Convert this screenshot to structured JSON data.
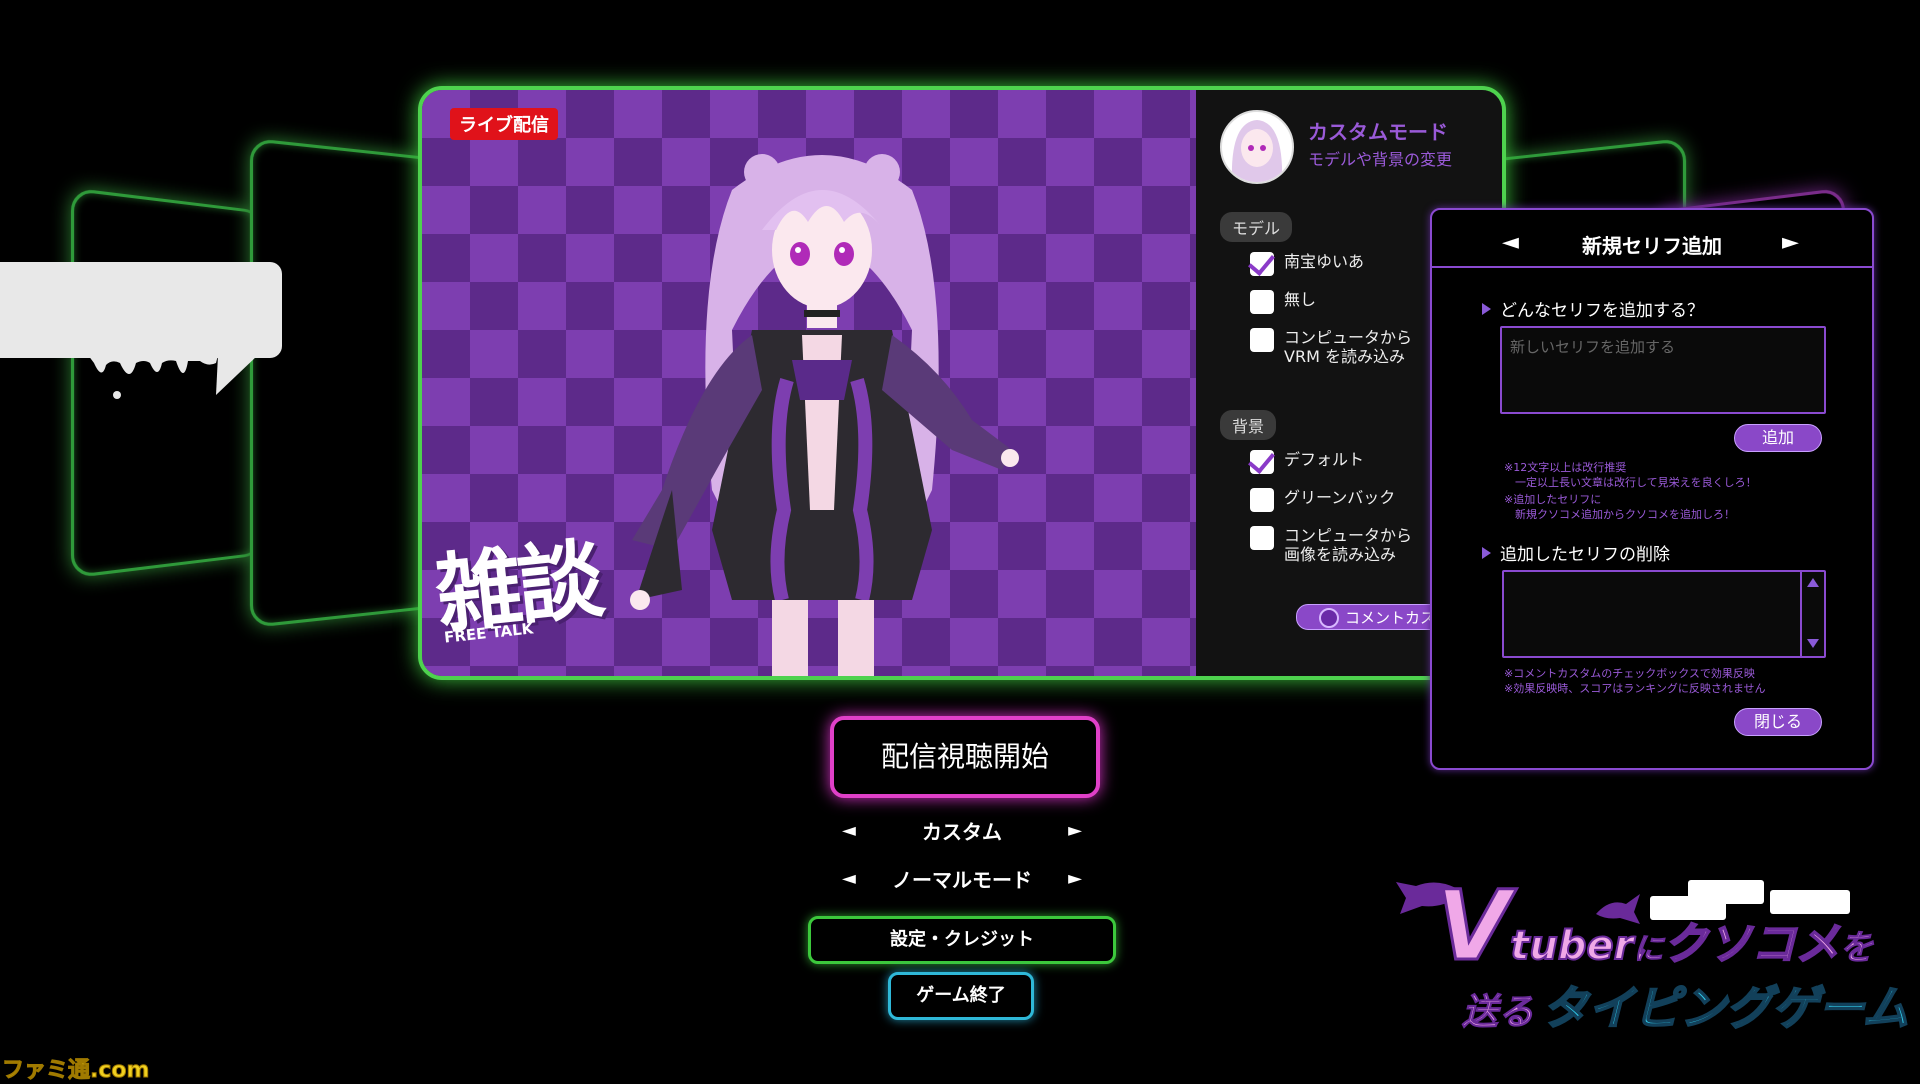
{
  "stream": {
    "live_badge": "ライブ配信",
    "overlay_logo_main": "雑談",
    "overlay_logo_sub": "FREE TALK"
  },
  "side_panel": {
    "mode_title": "カスタムモード",
    "mode_subtitle": "モデルや背景の変更",
    "model_section": "モデル",
    "model_options": [
      {
        "label": "南宝ゆいあ",
        "checked": true
      },
      {
        "label": "無し",
        "checked": false
      },
      {
        "label": "コンピュータから\nVRM を読み込み",
        "checked": false
      }
    ],
    "background_section": "背景",
    "background_options": [
      {
        "label": "デフォルト",
        "checked": true
      },
      {
        "label": "グリーンバック",
        "checked": false
      },
      {
        "label": "コンピュータから\n画像を読み込み",
        "checked": false
      }
    ],
    "comment_custom_toggle": "コメントカス"
  },
  "dialog": {
    "title": "新規セリフ追加",
    "prev_arrow": "◄",
    "next_arrow": "►",
    "add_section": "どんなセリフを追加する？",
    "input_placeholder": "新しいセリフを追加する",
    "add_button": "追加",
    "note1": "※12文字以上は改行推奨",
    "note2": "　一定以上長い文章は改行して見栄えを良くしろ！",
    "note3": "※追加したセリフに",
    "note4": "　新規クソコメ追加からクソコメを追加しろ！",
    "delete_section": "追加したセリフの削除",
    "note5": "※コメントカスタムのチェックボックスで効果反映",
    "note6": "※効果反映時、スコアはランキングに反映されません",
    "close_button": "閉じる"
  },
  "menu": {
    "start_button": "配信視聴開始",
    "mode_value": "カスタム",
    "difficulty_value": "ノーマルモード",
    "settings_button": "設定・クレジット",
    "quit_button": "ゲーム終了",
    "left_arrow": "◄",
    "right_arrow": "►"
  },
  "game_logo": {
    "line1a": "V",
    "line1b": "tuber",
    "line1c": "に",
    "line1d": "クソコメ",
    "line1e": "を",
    "line2a": "送る",
    "line2b": "タイピングゲーム"
  },
  "watermark": "ファミ通.com",
  "colors": {
    "green_glow": "#4ed24e",
    "pink_glow": "#e040c8",
    "cyan_glow": "#2fb8d8",
    "accent_purple": "#8a48c8"
  }
}
